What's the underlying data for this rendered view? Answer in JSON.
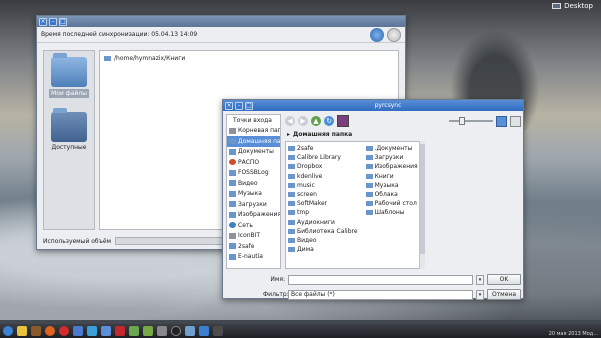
{
  "desktop": {
    "label": "Desktop"
  },
  "main_window": {
    "title": "",
    "last_sync_label": "Время последней синхронизации: 05.04.13 14:09",
    "left_panel": {
      "items": [
        {
          "label": "Мои файлы",
          "selected": true
        },
        {
          "label": "Доступные"
        }
      ]
    },
    "paths": [
      "/home/hymnazix/Книги"
    ],
    "usage_label": "Используемый объём",
    "usage_progress": 0.0
  },
  "dialog": {
    "title": "pyrcsync",
    "places_header": "Точки входа",
    "places": [
      {
        "label": "Корневая папка",
        "icon": "disk-icon"
      },
      {
        "label": "Домашняя па...",
        "icon": "home-folder-icon",
        "selected": true
      },
      {
        "label": "Документы",
        "icon": "folder-icon"
      },
      {
        "label": "РАСПО",
        "icon": "red-icon"
      },
      {
        "label": "FOSSBLog",
        "icon": "folder-icon"
      },
      {
        "label": "Видео",
        "icon": "folder-icon"
      },
      {
        "label": "Музыка",
        "icon": "folder-icon"
      },
      {
        "label": "Загрузки",
        "icon": "folder-icon"
      },
      {
        "label": "Изображения",
        "icon": "folder-icon"
      },
      {
        "label": "Сеть",
        "icon": "network-icon"
      },
      {
        "label": "IconBIT",
        "icon": "disk-icon"
      },
      {
        "label": "2safe",
        "icon": "folder-icon"
      },
      {
        "label": "E-nautia",
        "icon": "folder-icon"
      }
    ],
    "breadcrumb": "Домашняя папка",
    "files_col1": [
      "2safe",
      "Calibre Library",
      "Dropbox",
      "kdenlive",
      "music",
      "screen",
      "SoftMaker",
      "tmp",
      "Аудиокниги",
      "Библиотека Calibre",
      "Видео",
      "Дима"
    ],
    "files_col2": [
      ".Документы",
      "Загрузки",
      "Изображения",
      "Книги",
      "Музыка",
      "Облака",
      "Рабочий стол",
      "Шаблоны"
    ],
    "name_label": "Имя:",
    "name_value": "",
    "filter_label": "Фильтр:",
    "filter_value": "Все файлы (*)",
    "ok_label": "OK",
    "cancel_label": "Отмена"
  },
  "taskbar": {
    "clock_line1": "",
    "clock_line2": "20 мая 2013 Мод..."
  }
}
